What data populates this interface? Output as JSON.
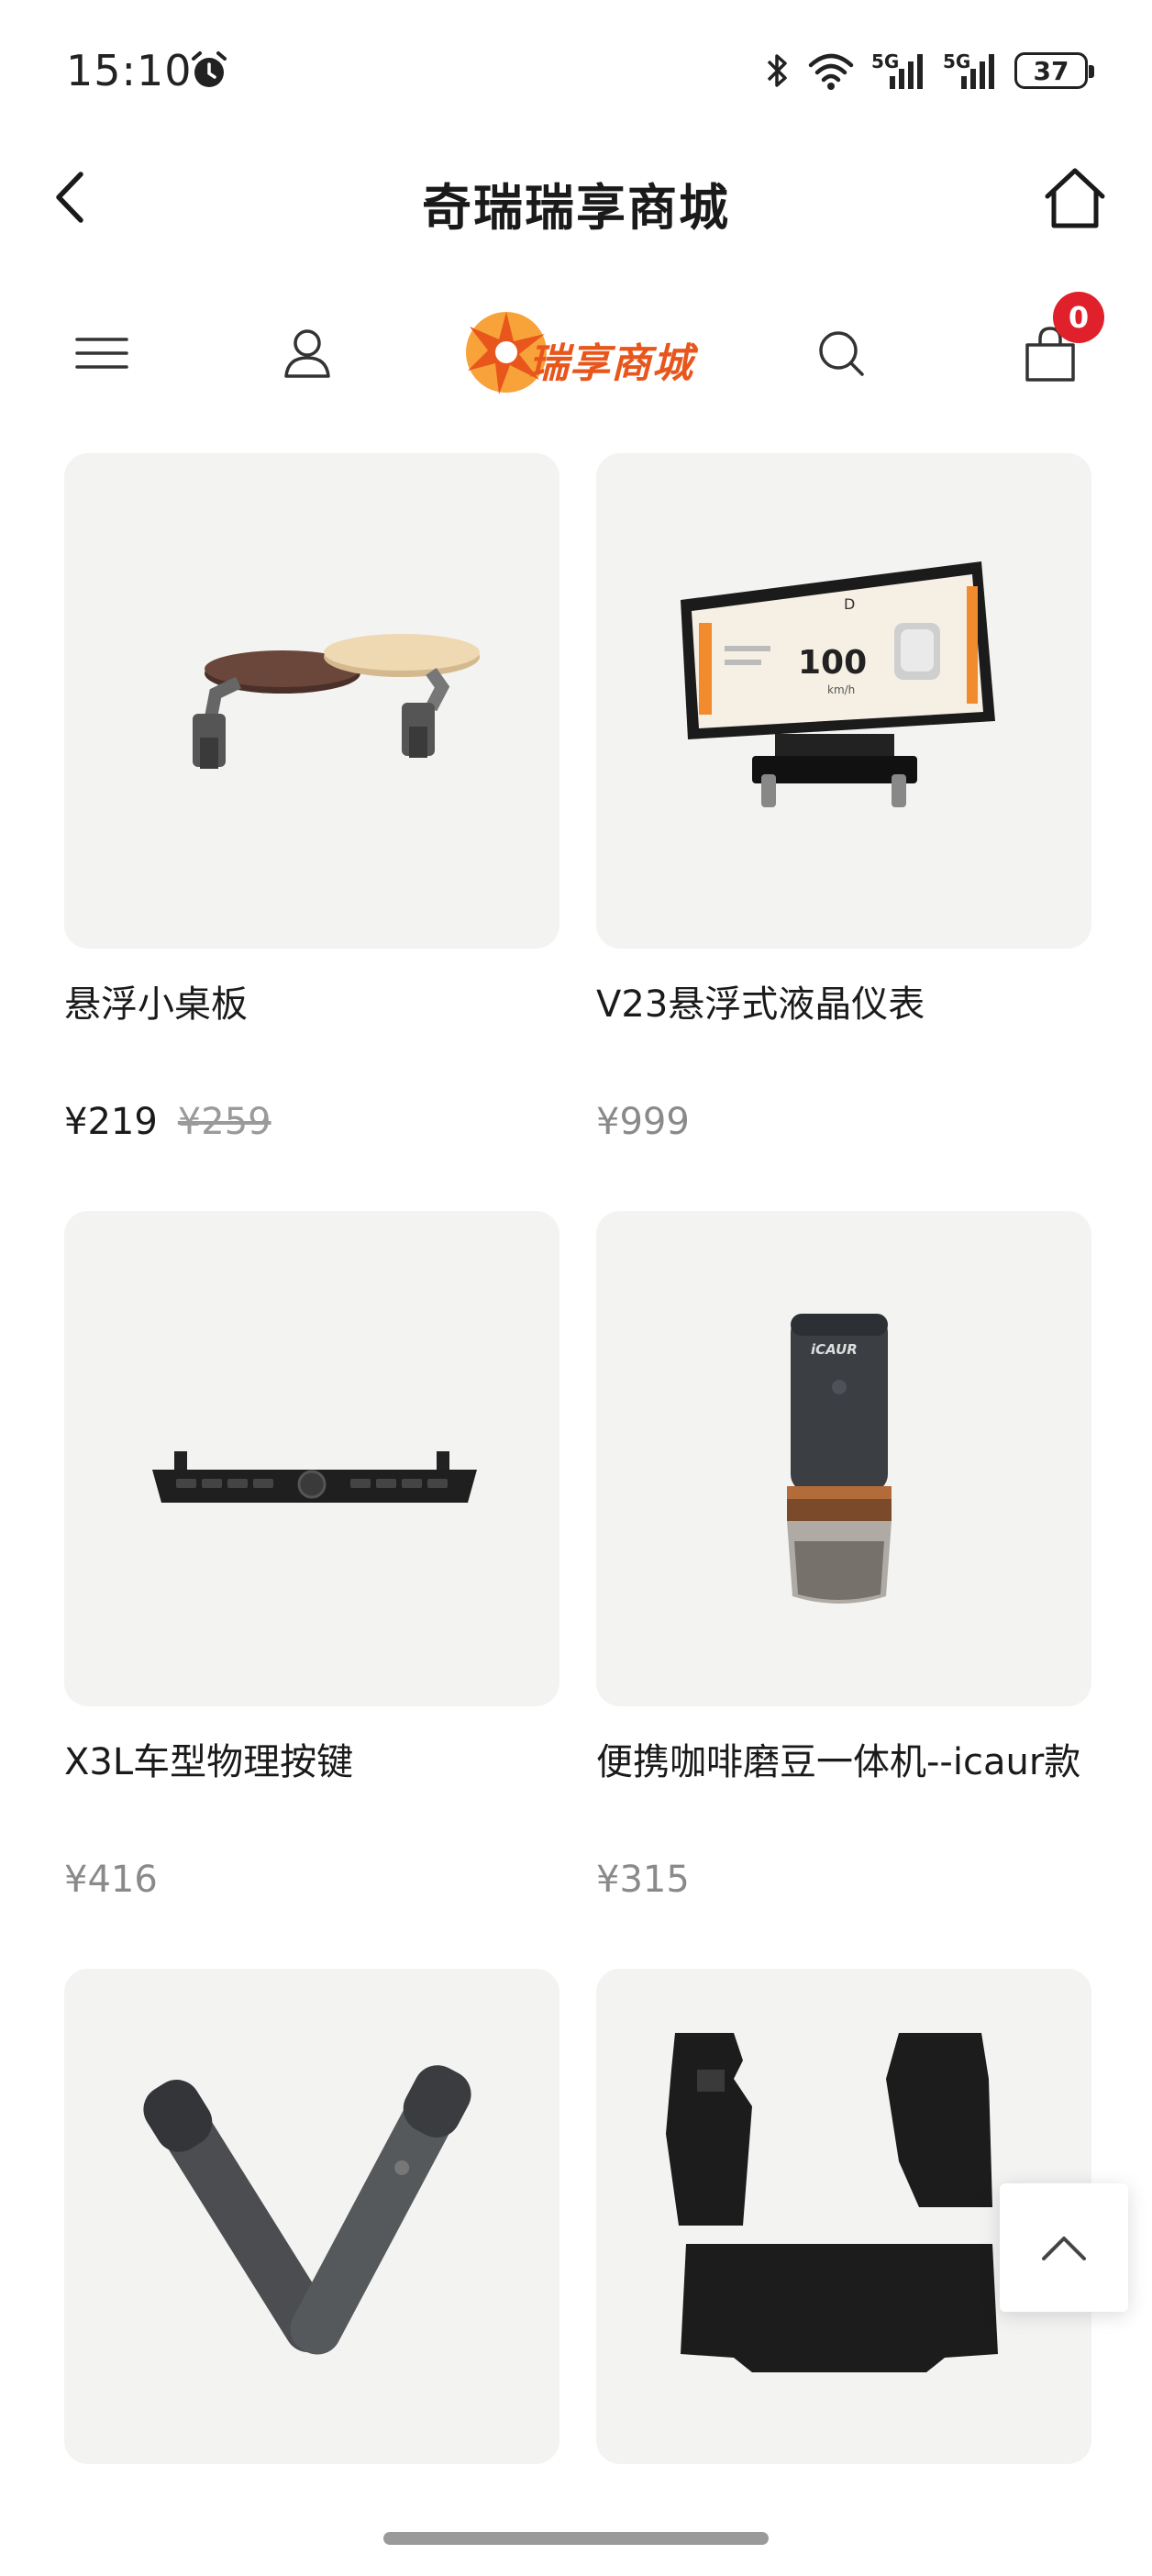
{
  "status_bar": {
    "time": "15:10",
    "battery": "37",
    "network_1": "5G",
    "network_2": "5G"
  },
  "header": {
    "title": "奇瑞瑞享商城"
  },
  "shop_nav": {
    "logo_text": "瑞享商城",
    "cart_count": "0"
  },
  "products": [
    {
      "name": "悬浮小桌板",
      "price": "¥219",
      "original_price": "¥259"
    },
    {
      "name": "V23悬浮式液晶仪表",
      "price": "¥999"
    },
    {
      "name": "X3L车型物理按键",
      "price": "¥416"
    },
    {
      "name": "便携咖啡磨豆一体机--icaur款",
      "price": "¥315"
    },
    {
      "name": "",
      "price": ""
    },
    {
      "name": "",
      "price": ""
    }
  ],
  "screen_content": {
    "speed": "100",
    "unit": "km/h",
    "gear": "D",
    "grinder_brand": "iCAUR"
  },
  "colors": {
    "accent": "#e8561c",
    "badge": "#e0202a",
    "card_bg": "#f3f3f2",
    "muted_price": "#8a8a8a"
  }
}
